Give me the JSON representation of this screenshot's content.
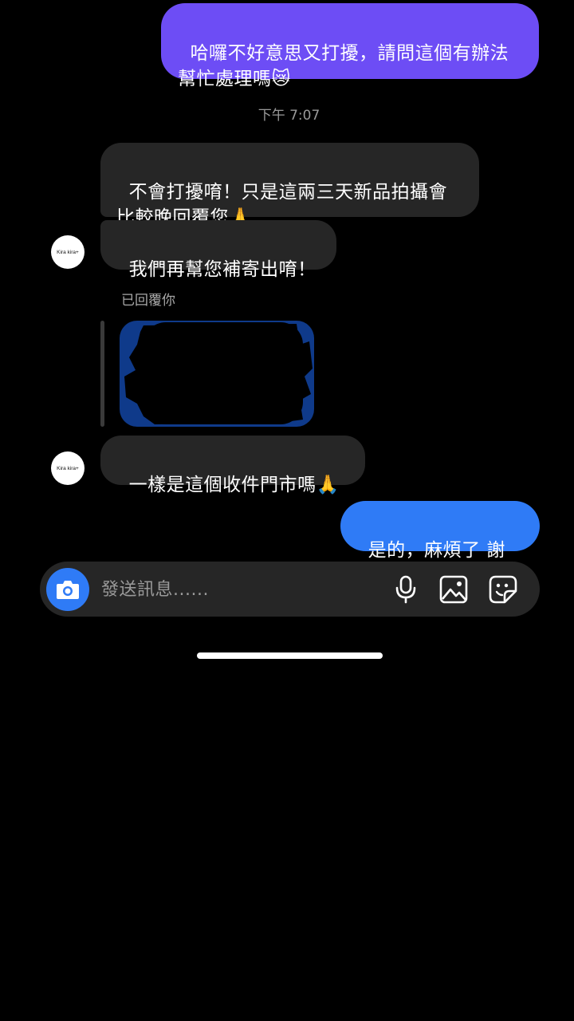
{
  "messages": {
    "outgoing_1": "哈囉不好意思又打擾，請問這個有辦法\n幫忙處理嗎😿",
    "timestamp": "下午 7:07",
    "incoming_1": "不會打擾唷！只是這兩三天新品拍攝會\n比較晚回覆您🙏",
    "incoming_2": "我們再幫您補寄出唷！",
    "replied_label": "已回覆你",
    "incoming_3": "一樣是這個收件門市嗎🙏",
    "outgoing_2": "是的，麻煩了 謝謝"
  },
  "contact": {
    "avatar_text": "Kira kira+"
  },
  "composer": {
    "placeholder": "發送訊息......"
  },
  "icons": {
    "camera": "camera-icon",
    "mic": "microphone-icon",
    "gallery": "image-icon",
    "sticker": "sticker-icon"
  },
  "colors": {
    "outgoing_top_bubble": "#6d4df5",
    "outgoing_bottom_bubble": "#2f7bf6",
    "incoming_bubble": "#262626",
    "background": "#000000",
    "accent": "#2f7bf6"
  }
}
